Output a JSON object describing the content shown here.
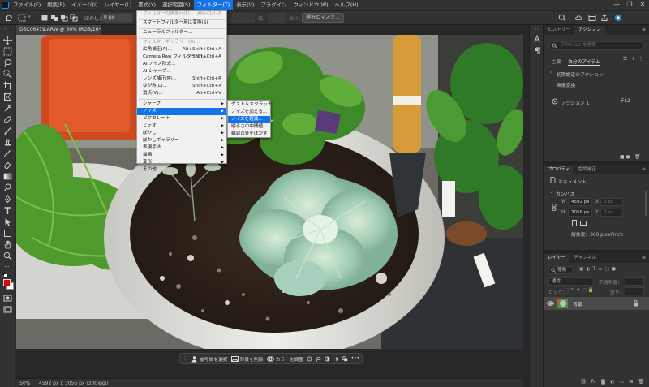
{
  "menubar": {
    "items": [
      "ファイル(F)",
      "編集(E)",
      "イメージ(I)",
      "レイヤー(L)",
      "書式(Y)",
      "選択範囲(S)",
      "フィルター(T)",
      "表示(V)",
      "プラグイン",
      "ウィンドウ(W)",
      "ヘルプ(H)"
    ],
    "active_index": 6,
    "accent_color": "#1473e6"
  },
  "window_controls": {
    "minimize": "—",
    "restore": "❐",
    "close": "✕"
  },
  "options_bar": {
    "feather_label": "ぼかし：",
    "feather_value": "0 px",
    "width_label": "幅：",
    "height_label": "高さ：",
    "select_and_mask_label": "選択とマスク..."
  },
  "document_tab": {
    "title": "DSC06479.ARW @ 50% (RGB/16*)",
    "close": "×"
  },
  "filter_menu": {
    "items": [
      {
        "label": "フィルターの再実行(F)",
        "shortcut": "Alt+Ctrl+F",
        "disabled": true
      },
      {
        "label": "スマートフィルター用に変換(S)",
        "shortcut": "",
        "disabled": false
      },
      {
        "label": "ニューラルフィルター...",
        "shortcut": "",
        "disabled": false
      },
      {
        "label": "フィルターギャラリー(G)...",
        "shortcut": "",
        "disabled": true
      },
      {
        "label": "広角補正(A)...",
        "shortcut": "Alt+Shift+Ctrl+A",
        "disabled": false
      },
      {
        "label": "Camera Raw フィルター(C)...",
        "shortcut": "Shift+Ctrl+A",
        "disabled": false
      },
      {
        "label": "AI ノイズ除去...",
        "shortcut": "",
        "disabled": false
      },
      {
        "label": "AI シャープ...",
        "shortcut": "",
        "disabled": false
      },
      {
        "label": "レンズ補正(R)...",
        "shortcut": "Shift+Ctrl+R",
        "disabled": false
      },
      {
        "label": "ゆがみ(L)...",
        "shortcut": "Shift+Ctrl+X",
        "disabled": false
      },
      {
        "label": "消点(V)...",
        "shortcut": "Alt+Ctrl+V",
        "disabled": false
      },
      {
        "label": "シャープ",
        "shortcut": "",
        "disabled": false,
        "submenu": true
      },
      {
        "label": "ノイズ",
        "shortcut": "",
        "disabled": false,
        "submenu": true,
        "highlighted": true
      },
      {
        "label": "ピクセレート",
        "shortcut": "",
        "disabled": false,
        "submenu": true
      },
      {
        "label": "ビデオ",
        "shortcut": "",
        "disabled": false,
        "submenu": true
      },
      {
        "label": "ぼかし",
        "shortcut": "",
        "disabled": false,
        "submenu": true
      },
      {
        "label": "ぼかしギャラリー",
        "shortcut": "",
        "disabled": false,
        "submenu": true
      },
      {
        "label": "表現手法",
        "shortcut": "",
        "disabled": false,
        "submenu": true
      },
      {
        "label": "描画",
        "shortcut": "",
        "disabled": false,
        "submenu": true
      },
      {
        "label": "変形",
        "shortcut": "",
        "disabled": false,
        "submenu": true
      },
      {
        "label": "その他",
        "shortcut": "",
        "disabled": false,
        "submenu": true
      }
    ]
  },
  "noise_submenu": {
    "items": [
      {
        "label": "ダスト＆スクラッチ...",
        "highlighted": false
      },
      {
        "label": "ノイズを加える...",
        "highlighted": false
      },
      {
        "label": "ノイズを軽減...",
        "highlighted": true
      },
      {
        "label": "明るさの中間値...",
        "highlighted": false
      },
      {
        "label": "輪郭以外をぼかす",
        "highlighted": false
      }
    ]
  },
  "taskbar": {
    "select_subject": "被写体を選択",
    "remove_background": "背景を削除",
    "adjust_color": "カラーを調整",
    "more": "•••"
  },
  "statusbar": {
    "zoom": "50%",
    "doc_info": "4592 px x 3056 px (300 ppi)",
    "arrow": "›"
  },
  "panels": {
    "history_tab": "ヒストリー",
    "actions_tab": "アクション",
    "search_placeholder": "アクションを検索",
    "sub_tabs": [
      "主要",
      "自分のアイテム"
    ],
    "active_sub_tab": 1,
    "actions": [
      {
        "label": "初期設定のアクション",
        "expanded": false
      },
      {
        "label": "画像変換",
        "expanded": true
      },
      {
        "label": "アクション 1",
        "shortcut": "F12"
      }
    ],
    "properties_tab": "プロパティ",
    "color_adjust_tab": "色調補正",
    "document_label": "ドキュメント",
    "canvas_label": "カンバス",
    "w_label": "W",
    "w_value": "4592 px",
    "h_label": "H",
    "h_value": "3056 px",
    "x_label": "X",
    "x_value": "0 px",
    "y_label": "Y",
    "y_value": "0 px",
    "resolution": "解像度：300 pixel/inch",
    "layers_tab": "レイヤー",
    "channels_tab": "チャンネル",
    "kind_label": "種類",
    "blend_mode": "通常",
    "opacity_label": "不透明度：",
    "lock_label": "ロック：",
    "fill_label": "塗り：",
    "layer_name": "背景"
  }
}
